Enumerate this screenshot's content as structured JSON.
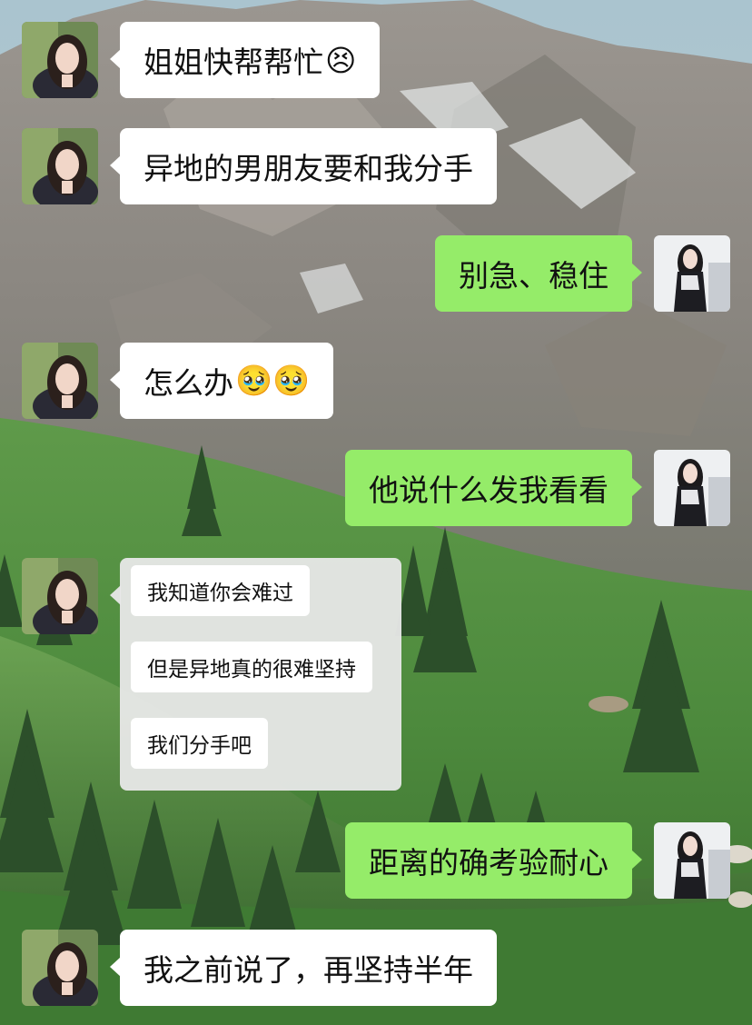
{
  "colors": {
    "sent_bubble": "#95ec69",
    "received_bubble": "#ffffff",
    "quote_card": "#e8e8e8"
  },
  "messages": [
    {
      "side": "left",
      "text": "姐姐快帮帮忙",
      "emoji": "😣"
    },
    {
      "side": "left",
      "text": "异地的男朋友要和我分手"
    },
    {
      "side": "right",
      "text": "别急、稳住"
    },
    {
      "side": "left",
      "text": "怎么办",
      "emoji": "🥹🥹"
    },
    {
      "side": "right",
      "text": "他说什么发我看看"
    },
    {
      "side": "left",
      "type": "quoted-chat",
      "quotes": [
        "我知道你会难过",
        "但是异地真的很难坚持",
        "我们分手吧"
      ]
    },
    {
      "side": "right",
      "text": "距离的确考验耐心"
    },
    {
      "side": "left",
      "text": "我之前说了，再坚持半年"
    }
  ],
  "avatars": {
    "left": "girl-photo-avatar",
    "right": "dark-dress-avatar"
  }
}
